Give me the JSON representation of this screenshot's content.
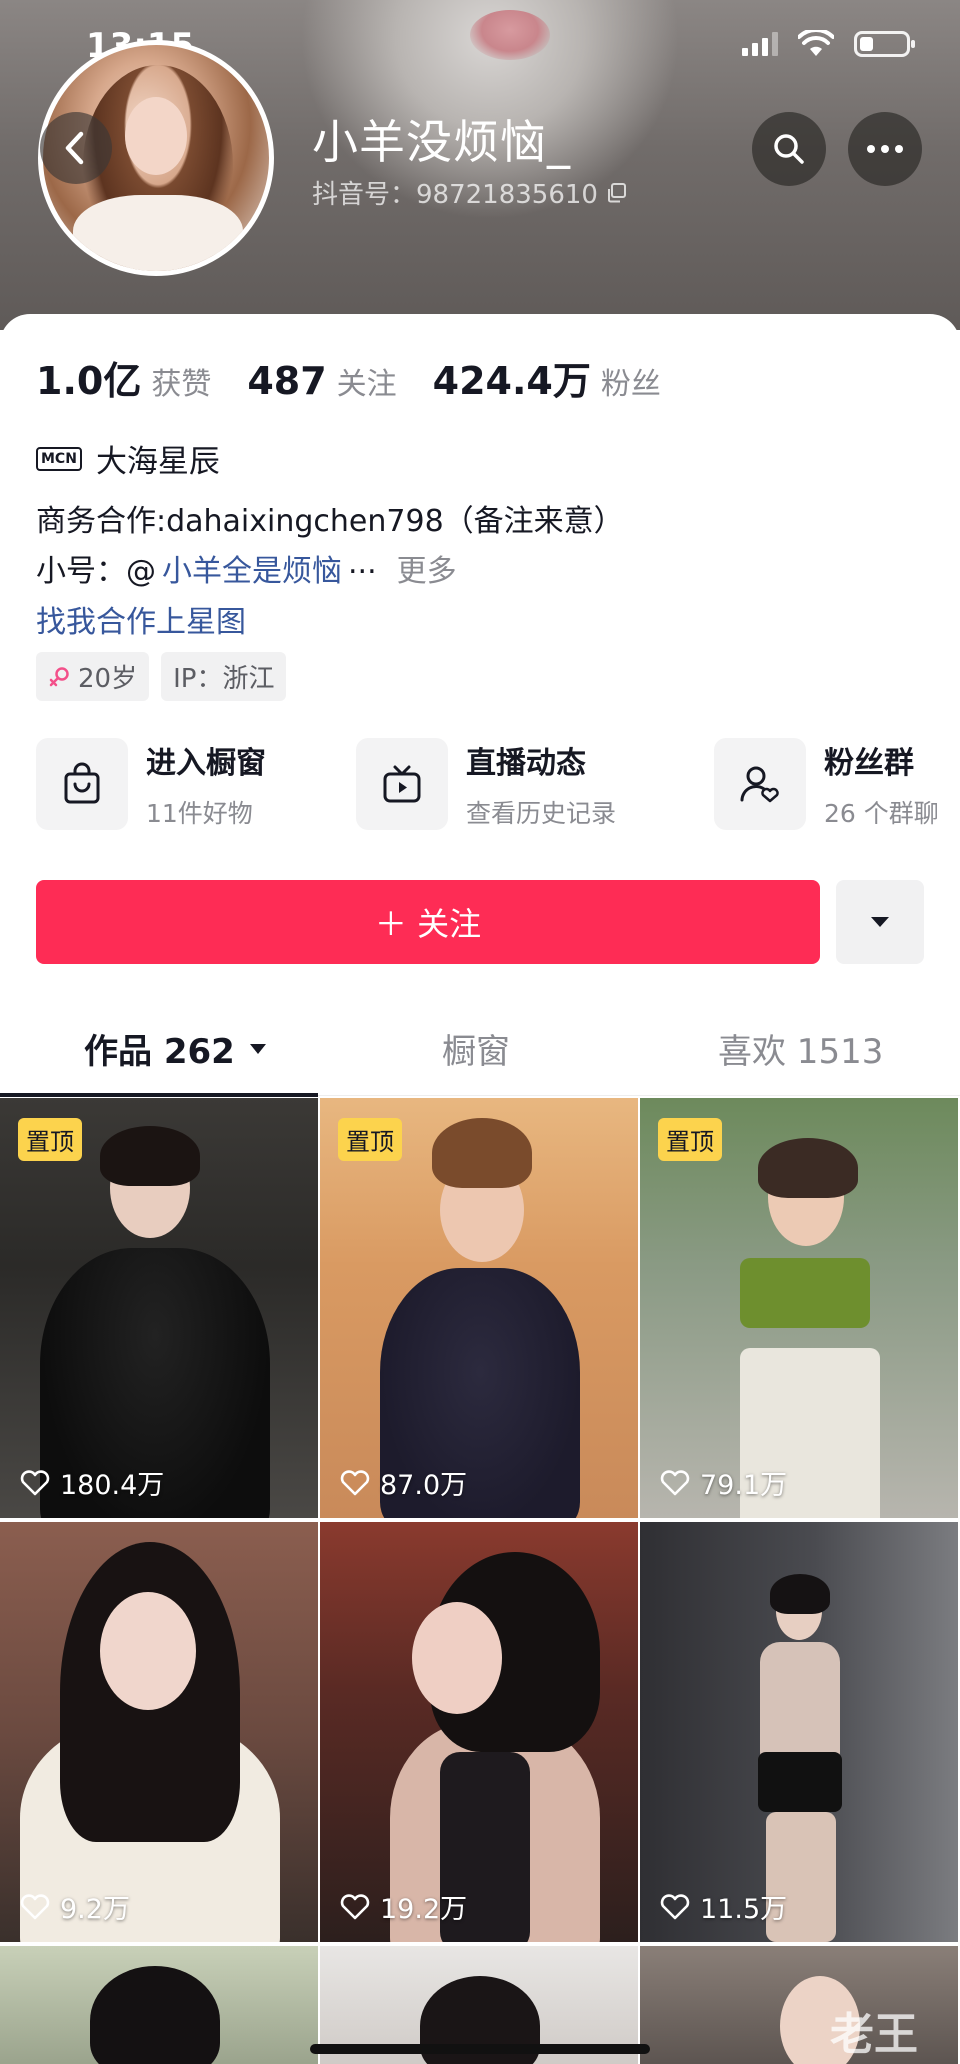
{
  "status_bar": {
    "time": "13:15",
    "battery_level": 0.3
  },
  "profile": {
    "nickname": "小羊没烦恼_",
    "douyin_id": "抖音号：98721835610"
  },
  "stats": [
    {
      "value": "1.0亿",
      "label": "获赞"
    },
    {
      "value": "487",
      "label": "关注"
    },
    {
      "value": "424.4万",
      "label": "粉丝"
    }
  ],
  "mcn": {
    "badge": "MCN",
    "name": "大海星辰"
  },
  "bio": {
    "line1": "商务合作:dahaixingchen798（备注来意）",
    "line2_prefix": "小号：@",
    "line2_link": "小羊全是烦恼",
    "line2_ellipsis": "...",
    "line2_more": "更多",
    "line3": "找我合作上星图"
  },
  "tags": {
    "age": "20岁",
    "ip": "IP：浙江"
  },
  "shortcuts": [
    {
      "title": "进入橱窗",
      "subtitle": "11件好物",
      "icon": "shopping-bag-icon"
    },
    {
      "title": "直播动态",
      "subtitle": "查看历史记录",
      "icon": "tv-icon"
    },
    {
      "title": "粉丝群",
      "subtitle": "26 个群聊",
      "icon": "group-icon"
    }
  ],
  "follow": {
    "label": "＋ 关注"
  },
  "tabs": {
    "works": "作品 262",
    "shop": "橱窗",
    "likes": "喜欢 1513"
  },
  "videos": [
    {
      "pinned": "置顶",
      "likes": "180.4万"
    },
    {
      "pinned": "置顶",
      "likes": "87.0万"
    },
    {
      "pinned": "置顶",
      "likes": "79.1万"
    },
    {
      "pinned": "",
      "likes": "9.2万"
    },
    {
      "pinned": "",
      "likes": "19.2万"
    },
    {
      "pinned": "",
      "likes": "11.5万"
    }
  ],
  "watermark": "老王",
  "colors": {
    "accent": "#fe2c55",
    "link": "#37579c",
    "pin_badge": "#fcd34d",
    "muted_text": "#8a8b91"
  }
}
